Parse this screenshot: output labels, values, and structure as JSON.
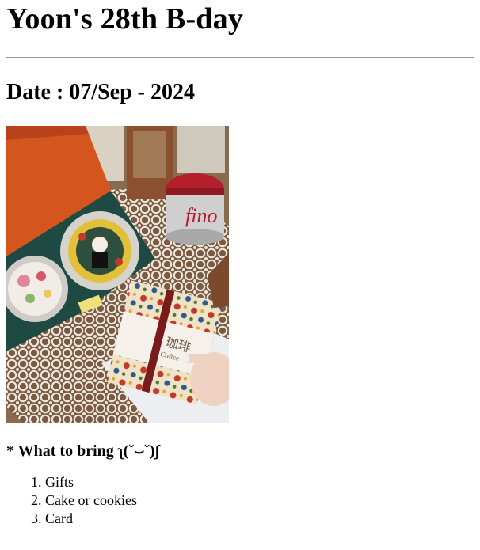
{
  "page": {
    "title": "Yoon's 28th B-day",
    "date_heading": "Date : 07/Sep - 2024",
    "what_to_bring_heading": "* What to bring ʅ(˘⌣˘)ʃ",
    "items": [
      "Gifts",
      "Cake or cookies",
      "Card"
    ]
  },
  "photo": {
    "alt": "Birthday gifts photo",
    "tin_label": "fino",
    "pouch_label": "Coffee",
    "pouch_kanji": "珈琲"
  },
  "colors": {
    "text": "#000000",
    "rule": "#9a9a9a",
    "background": "#ffffff",
    "box_orange": "#d4561e",
    "box_green": "#1f4a43",
    "tin_red": "#b51f2c",
    "lace": "#ece6da"
  }
}
